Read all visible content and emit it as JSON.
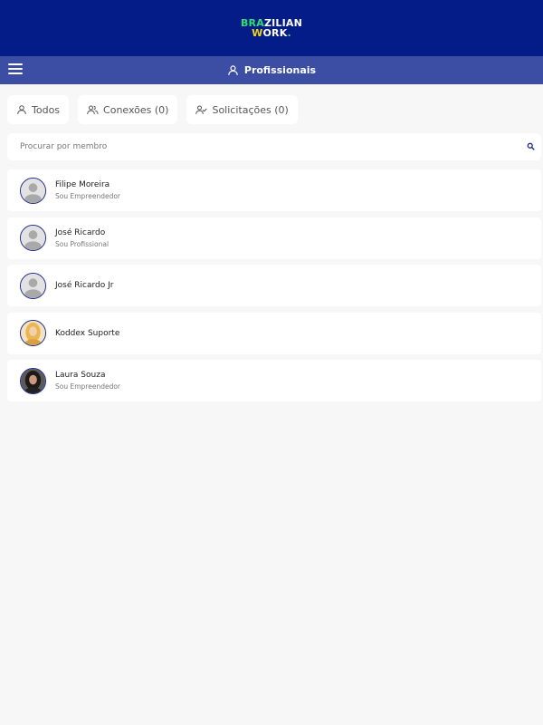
{
  "brand": {
    "line1_green": "BRA",
    "line1_white": "ZILIAN",
    "line2_yellow": "W",
    "line2_white": "ORK",
    "line2_dot": ".",
    "colors": {
      "green": "#2ee06a",
      "yellow": "#f5d21f",
      "navy": "#031c88"
    }
  },
  "nav": {
    "title": "Profissionais",
    "icon": "user-icon"
  },
  "filters": [
    {
      "label": "Todos",
      "icon": "user-icon"
    },
    {
      "label": "Conexões (0)",
      "icon": "users-icon"
    },
    {
      "label": "Solicitações (0)",
      "icon": "user-check-icon"
    }
  ],
  "search": {
    "placeholder": "Procurar por membro",
    "icon": "search-icon"
  },
  "members": [
    {
      "name": "Filipe Moreira",
      "role": "Sou Empreendedor",
      "avatar": "default"
    },
    {
      "name": "José Ricardo",
      "role": "Sou Profissional",
      "avatar": "default"
    },
    {
      "name": "José Ricardo Jr",
      "role": "",
      "avatar": "default"
    },
    {
      "name": "Koddex Suporte",
      "role": "",
      "avatar": "photo-blonde"
    },
    {
      "name": "Laura Souza",
      "role": "Sou Empreendedor",
      "avatar": "photo-dark"
    }
  ]
}
